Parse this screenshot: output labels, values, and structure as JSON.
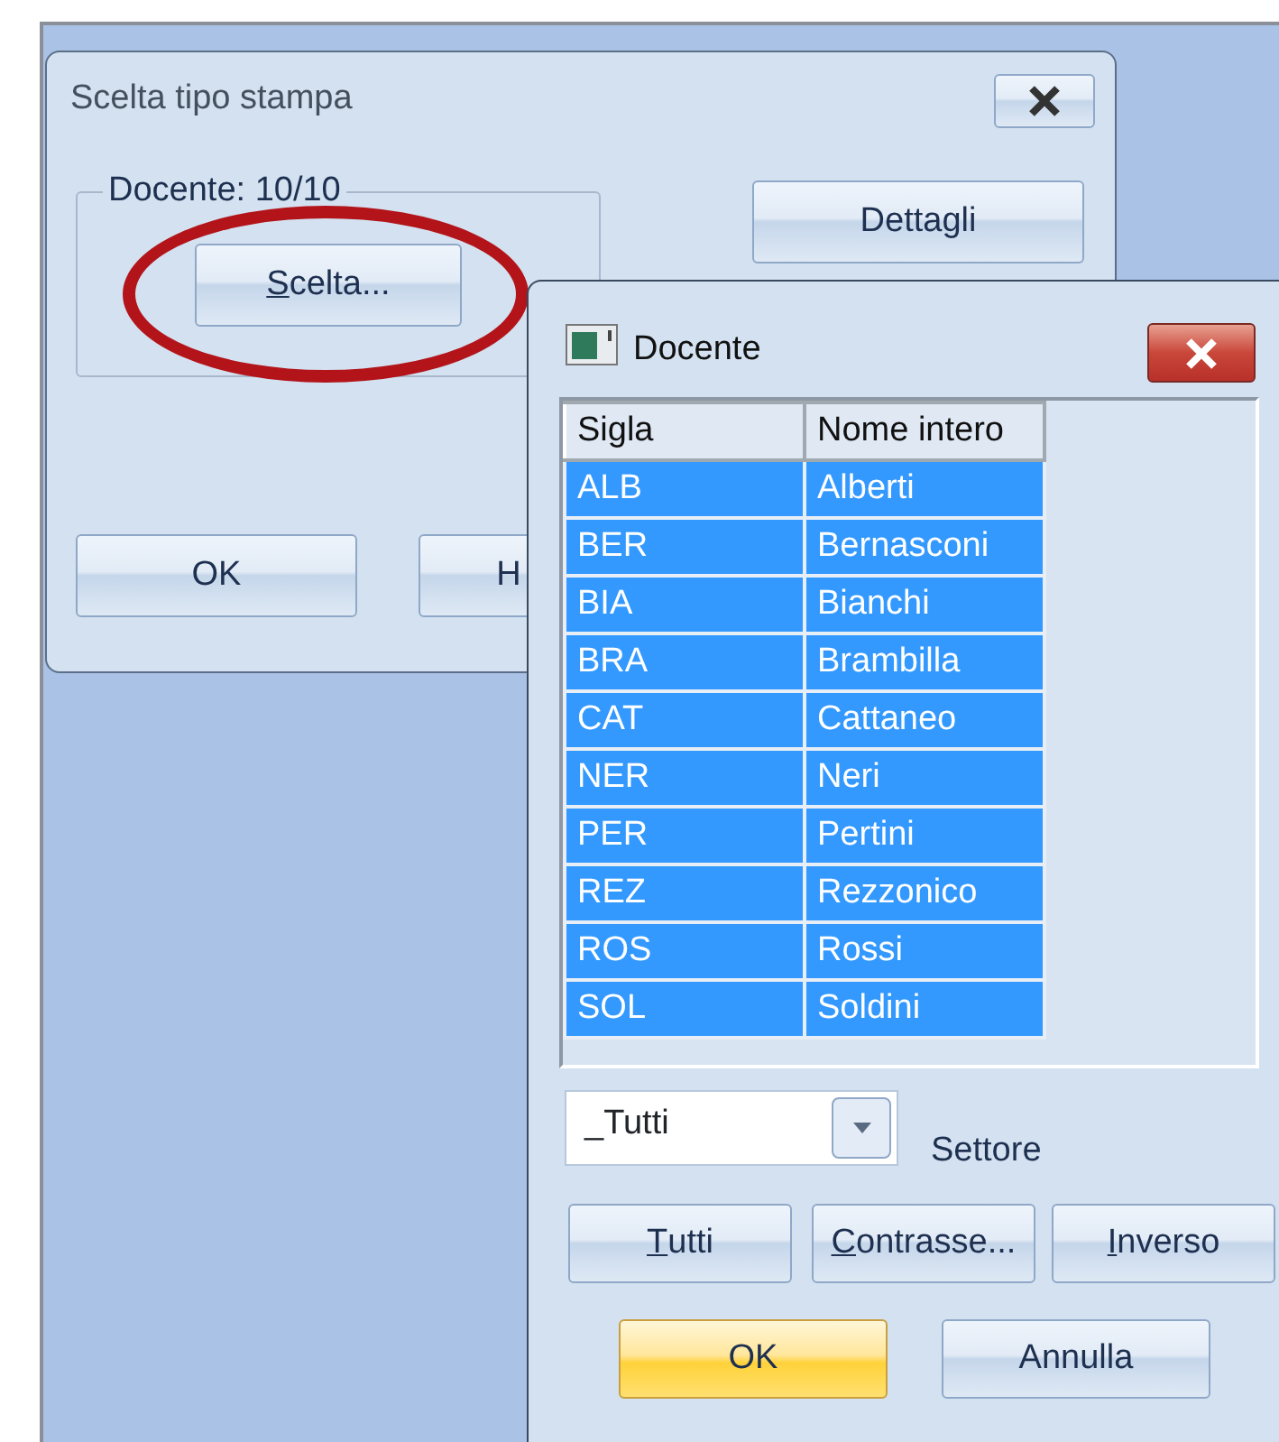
{
  "main_dialog": {
    "title": "Scelta tipo stampa",
    "group_label": "Docente: 10/10",
    "buttons": [
      {
        "label": "Scelta...",
        "kind": "group",
        "underline_first": true,
        "circled": true
      },
      {
        "label": "Dettagli",
        "kind": "side",
        "underline_first": false,
        "circled": false
      },
      {
        "label": "OK",
        "kind": "ok",
        "underline_first": false,
        "circled": false
      },
      {
        "label": "H",
        "kind": "cut",
        "underline_first": false,
        "circled": false
      }
    ]
  },
  "docente_dialog": {
    "title": "Docente",
    "table": {
      "columns": [
        "Sigla",
        "Nome intero"
      ],
      "rows": [
        {
          "cells": [
            "ALB",
            "Alberti"
          ],
          "selected": true
        },
        {
          "cells": [
            "BER",
            "Bernasconi"
          ],
          "selected": true
        },
        {
          "cells": [
            "BIA",
            "Bianchi"
          ],
          "selected": true
        },
        {
          "cells": [
            "BRA",
            "Brambilla"
          ],
          "selected": true
        },
        {
          "cells": [
            "CAT",
            "Cattaneo"
          ],
          "selected": true
        },
        {
          "cells": [
            "NER",
            "Neri"
          ],
          "selected": true
        },
        {
          "cells": [
            "PER",
            "Pertini"
          ],
          "selected": true
        },
        {
          "cells": [
            "REZ",
            "Rezzonico"
          ],
          "selected": true
        },
        {
          "cells": [
            "ROS",
            "Rossi"
          ],
          "selected": true
        },
        {
          "cells": [
            "SOL",
            "Soldini"
          ],
          "selected": true
        }
      ]
    },
    "combo": {
      "value": "_Tutti",
      "label": "Settore"
    },
    "filter_buttons": [
      {
        "label": "Tutti",
        "underline_first": true
      },
      {
        "label": "Contrasse...",
        "underline_first": true
      },
      {
        "label": "Inverso",
        "underline_first": true
      }
    ],
    "action_buttons": [
      {
        "label": "OK",
        "default": true
      },
      {
        "label": "Annulla",
        "default": false
      }
    ]
  }
}
